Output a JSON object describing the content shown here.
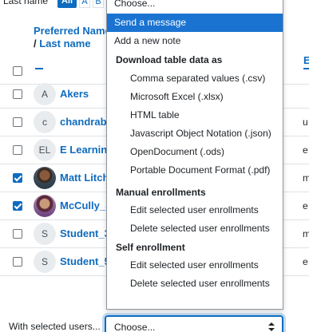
{
  "filter": {
    "lastname_label": "Last name",
    "all_label": "All",
    "letter_a": "A",
    "letter_b": "B"
  },
  "table": {
    "header": {
      "name_line1": "Preferred Name",
      "slash": "/",
      "name_line2": "Last name",
      "roles_partial": "r",
      "email_partial": "E"
    },
    "rows": [
      {
        "avatar_initials": "A",
        "name": "Akers",
        "checked": false,
        "r": ""
      },
      {
        "avatar_initials": "c",
        "name": "chandraba",
        "checked": false,
        "r": "u"
      },
      {
        "avatar_initials": "EL",
        "name": "E Learning",
        "checked": false,
        "r": "e"
      },
      {
        "avatar_initials": "",
        "name": "Matt Litch",
        "checked": true,
        "r": "m"
      },
      {
        "avatar_initials": "",
        "name": "McCully_S",
        "checked": true,
        "r": "e"
      },
      {
        "avatar_initials": "S",
        "name": "Student_3",
        "checked": false,
        "r": "m"
      },
      {
        "avatar_initials": "S",
        "name": "Student_5",
        "checked": false,
        "r": "e"
      }
    ]
  },
  "bulk": {
    "with_selected_label": "With selected users...",
    "select_value": "Choose..."
  },
  "dropdown": {
    "choose": "Choose...",
    "send_message": "Send a message",
    "add_note": "Add a new note",
    "group_download": "Download table data as",
    "csv": "Comma separated values (.csv)",
    "xlsx": "Microsoft Excel (.xlsx)",
    "html": "HTML table",
    "json": "Javascript Object Notation (.json)",
    "ods": "OpenDocument (.ods)",
    "pdf": "Portable Document Format (.pdf)",
    "group_manual": "Manual enrollments",
    "manual_edit": "Edit selected user enrollments",
    "manual_delete": "Delete selected user enrollments",
    "group_self": "Self enrollment",
    "self_edit": "Edit selected user enrollments",
    "self_delete": "Delete selected user enrollments"
  },
  "colors": {
    "accent": "#0f6cbf",
    "highlight": "#1a73d1"
  }
}
